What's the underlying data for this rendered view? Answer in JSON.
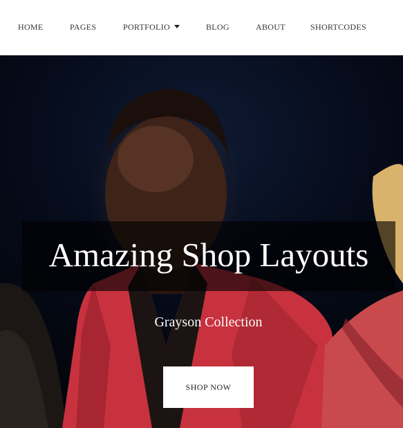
{
  "nav": {
    "items": [
      {
        "label": "HOME"
      },
      {
        "label": "PAGES"
      },
      {
        "label": "PORTFOLIO",
        "icon": "caret-down-icon"
      },
      {
        "label": "BLOG"
      },
      {
        "label": "ABOUT"
      },
      {
        "label": "SHORTCODES"
      }
    ]
  },
  "hero": {
    "title": "Amazing Shop Layouts",
    "subtitle": "Grayson Collection",
    "cta_label": "SHOP NOW"
  },
  "colors": {
    "nav_background": "#ffffff",
    "hero_background": "#060c1c",
    "jacket_red": "#c8323f",
    "button_background": "#ffffff"
  }
}
